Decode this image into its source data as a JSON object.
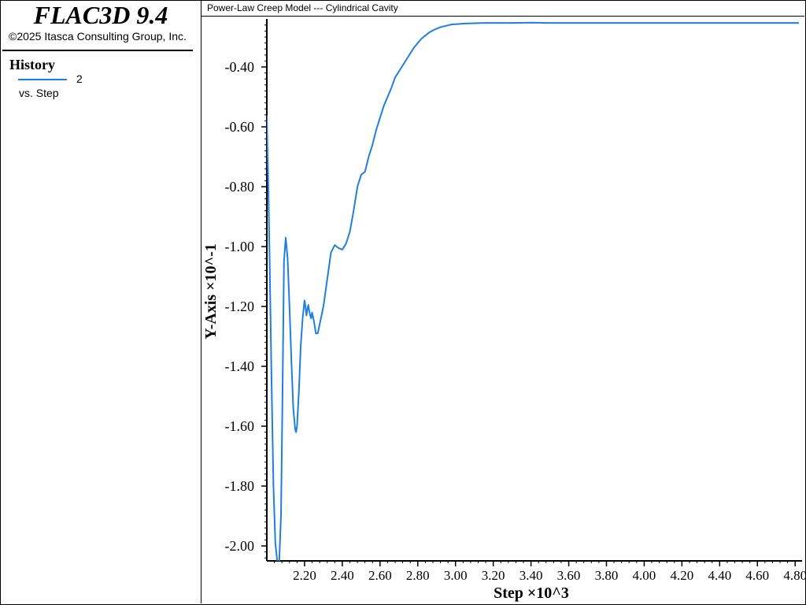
{
  "app": {
    "title": "FLAC3D 9.4",
    "copyright": "©2025 Itasca Consulting Group, Inc."
  },
  "legend": {
    "heading": "History",
    "series_name": "2",
    "vs_label": "vs. Step",
    "color": "#1e7fe0"
  },
  "plot": {
    "title": "Power-Law Creep Model --- Cylindrical Cavity"
  },
  "chart_data": {
    "type": "line",
    "xlabel": "Step ×10^3",
    "ylabel": "Y-Axis ×10^-1",
    "xlim": [
      2.0,
      4.82
    ],
    "ylim": [
      -2.05,
      -0.25
    ],
    "x_ticks": [
      "2.20",
      "2.40",
      "2.60",
      "2.80",
      "3.00",
      "3.20",
      "3.40",
      "3.60",
      "3.80",
      "4.00",
      "4.20",
      "4.40",
      "4.60",
      "4.80"
    ],
    "y_ticks": [
      "-0.40",
      "-0.60",
      "-0.80",
      "-1.00",
      "-1.20",
      "-1.40",
      "-1.60",
      "-1.80",
      "-2.00"
    ],
    "grid": false,
    "series": [
      {
        "name": "2",
        "color": "#1e7fe0",
        "x": [
          2.0,
          2.003,
          2.008,
          2.015,
          2.025,
          2.035,
          2.045,
          2.055,
          2.065,
          2.075,
          2.083,
          2.091,
          2.1,
          2.11,
          2.12,
          2.13,
          2.14,
          2.15,
          2.155,
          2.16,
          2.17,
          2.18,
          2.19,
          2.2,
          2.205,
          2.21,
          2.215,
          2.22,
          2.225,
          2.23,
          2.235,
          2.24,
          2.25,
          2.26,
          2.27,
          2.28,
          2.3,
          2.32,
          2.34,
          2.36,
          2.38,
          2.4,
          2.42,
          2.44,
          2.46,
          2.48,
          2.5,
          2.52,
          2.54,
          2.56,
          2.58,
          2.6,
          2.62,
          2.64,
          2.66,
          2.68,
          2.7,
          2.72,
          2.74,
          2.76,
          2.78,
          2.8,
          2.82,
          2.84,
          2.86,
          2.88,
          2.9,
          2.92,
          2.94,
          2.96,
          2.98,
          3.0,
          3.05,
          3.1,
          3.15,
          3.2,
          3.3,
          3.4,
          3.5,
          3.6,
          3.8,
          4.0,
          4.2,
          4.4,
          4.6,
          4.82
        ],
        "values": [
          -0.562,
          -0.66,
          -0.8,
          -1.05,
          -1.45,
          -1.8,
          -1.99,
          -2.05,
          -2.06,
          -1.9,
          -1.5,
          -1.05,
          -0.97,
          -1.04,
          -1.2,
          -1.38,
          -1.54,
          -1.61,
          -1.62,
          -1.6,
          -1.48,
          -1.33,
          -1.24,
          -1.18,
          -1.2,
          -1.23,
          -1.21,
          -1.195,
          -1.215,
          -1.23,
          -1.24,
          -1.22,
          -1.25,
          -1.29,
          -1.29,
          -1.26,
          -1.2,
          -1.11,
          -1.02,
          -0.995,
          -1.005,
          -1.01,
          -0.99,
          -0.95,
          -0.88,
          -0.8,
          -0.76,
          -0.75,
          -0.7,
          -0.66,
          -0.61,
          -0.57,
          -0.53,
          -0.5,
          -0.47,
          -0.435,
          -0.415,
          -0.395,
          -0.375,
          -0.355,
          -0.335,
          -0.32,
          -0.305,
          -0.295,
          -0.285,
          -0.278,
          -0.272,
          -0.267,
          -0.264,
          -0.261,
          -0.258,
          -0.257,
          -0.255,
          -0.254,
          -0.253,
          -0.253,
          -0.253,
          -0.252,
          -0.253,
          -0.253,
          -0.253,
          -0.253,
          -0.253,
          -0.253,
          -0.253,
          -0.253
        ]
      }
    ]
  }
}
